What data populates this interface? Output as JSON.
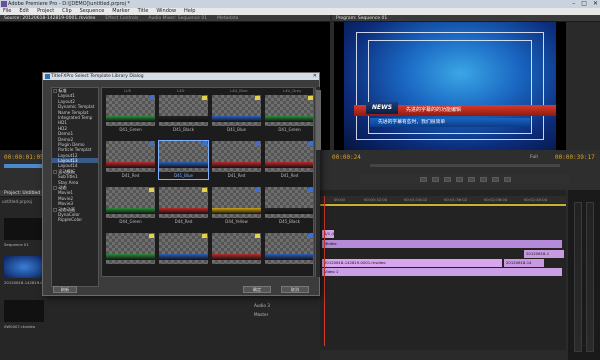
{
  "app": {
    "title": "Adobe Premiere Pro - D:\\[DEMO]\\untitled.prproj *",
    "menu": [
      "File",
      "Edit",
      "Project",
      "Clip",
      "Sequence",
      "Marker",
      "Title",
      "Window",
      "Help"
    ],
    "win_min": "–",
    "win_max": "□",
    "win_close": "✕"
  },
  "source_panel": {
    "tabs": [
      "Source: 20120618-142819-0001.rkvideo",
      "Effect Controls",
      "Audio Mixer: Sequence 01",
      "Metadata"
    ],
    "timecode": "00:00:01:05"
  },
  "program_panel": {
    "tabs": [
      "Program: Sequence 01"
    ],
    "timecode_left": "00:00:24",
    "timecode_right": "00:00:39:17",
    "fit_label": "Full",
    "news_tag": "NEWS",
    "news_text": "先进的字幕的的功能编辑",
    "sub_text": "先进的字幕有些时，我们很简单"
  },
  "dialog": {
    "title": "TitleFXPro Select Template Library Dialog",
    "tree": [
      {
        "label": "□ 标准",
        "kind": "grp"
      },
      {
        "label": "Layout1",
        "kind": "item"
      },
      {
        "label": "Layout2",
        "kind": "item"
      },
      {
        "label": "Dynamic Templat",
        "kind": "item"
      },
      {
        "label": "Name Templat",
        "kind": "item"
      },
      {
        "label": "Integrated Temp",
        "kind": "item"
      },
      {
        "label": "HD1",
        "kind": "item"
      },
      {
        "label": "HD2",
        "kind": "item"
      },
      {
        "label": "Demo1",
        "kind": "item"
      },
      {
        "label": "Demo2",
        "kind": "item"
      },
      {
        "label": "Plugin Demo",
        "kind": "item"
      },
      {
        "label": "Particle Templat",
        "kind": "item"
      },
      {
        "label": "Layout12",
        "kind": "item"
      },
      {
        "label": "Layout13",
        "kind": "sel"
      },
      {
        "label": "Layout14",
        "kind": "item"
      },
      {
        "label": "□ 运动模板",
        "kind": "grp"
      },
      {
        "label": "SubTitle1",
        "kind": "item"
      },
      {
        "label": "Stay Area",
        "kind": "item"
      },
      {
        "label": "□ 动态",
        "kind": "grp"
      },
      {
        "label": "Movie1",
        "kind": "item"
      },
      {
        "label": "Movie2",
        "kind": "item"
      },
      {
        "label": "Movie3",
        "kind": "item"
      },
      {
        "label": "□ 动态动画",
        "kind": "grp"
      },
      {
        "label": "DynaColor",
        "kind": "item"
      },
      {
        "label": "RippleColor",
        "kind": "item"
      }
    ],
    "column_headers": [
      "LUS",
      "L4D",
      "L4U_Blue",
      "L4U_Grey"
    ],
    "thumbs": [
      {
        "label": "D41_Green",
        "bar": "#2c8a3a",
        "badge": "blue"
      },
      {
        "label": "D41_Black",
        "bar": "#222222",
        "badge": "yellow"
      },
      {
        "label": "D41_Blue",
        "bar": "#2a5fb8",
        "badge": "yellow"
      },
      {
        "label": "D41_Green",
        "bar": "#2c8a3a",
        "badge": "yellow"
      },
      {
        "label": "D41_Red",
        "bar": "#b82a2a",
        "badge": "blue"
      },
      {
        "label": "D41_Blue",
        "bar": "#2a5fb8",
        "badge": "blue"
      },
      {
        "label": "D41_Red",
        "bar": "#b82a2a",
        "badge": "blue"
      },
      {
        "label": "D41_Red",
        "bar": "#b82a2a",
        "badge": "blue"
      },
      {
        "label": "D44_Green",
        "bar": "#2c8a3a",
        "badge": "yellow"
      },
      {
        "label": "D44_Red",
        "bar": "#b82a2a",
        "badge": "yellow"
      },
      {
        "label": "D44_Yellow",
        "bar": "#c9a21a",
        "badge": "blue"
      },
      {
        "label": "D45_Black",
        "bar": "#222222",
        "badge": "blue"
      },
      {
        "label": "",
        "bar": "#2c8a3a",
        "badge": "yellow"
      },
      {
        "label": "",
        "bar": "#2a5fb8",
        "badge": "yellow"
      },
      {
        "label": "",
        "bar": "#b82a2a",
        "badge": "yellow"
      },
      {
        "label": "",
        "bar": "#2a5fb8",
        "badge": "blue"
      }
    ],
    "selected_index": 5,
    "btn_left": "刷新",
    "btn_ok": "确定",
    "btn_cancel": "取消"
  },
  "project_panel": {
    "tabs": [
      "Project: Untitled",
      "Me"
    ],
    "file": "untitled.prproj",
    "items": [
      {
        "name": "Sequence 01",
        "info": ""
      },
      {
        "name": "20120618-142819-0001.rkvideo",
        "info": "00:00:01:06"
      },
      {
        "name": "00:00:0:11",
        "info": ""
      },
      {
        "name": "0W0007.rkvideo",
        "info": ""
      }
    ]
  },
  "timeline": {
    "ruler": [
      "00:00",
      "00:00:32:00",
      "00:01:04:02",
      "00:01:36:02",
      "00:02:08:04",
      "00:02:40:04"
    ],
    "clips": [
      {
        "label": "1/1 (W)",
        "color": "#d4a4e8"
      },
      {
        "label": "Middle",
        "color": "#b58ad8"
      },
      {
        "label": "20120618-1",
        "color": "#c99ae0"
      },
      {
        "label": "20120618-142819-0001.rkvideo",
        "color": "#d7a6ee"
      },
      {
        "label": "20120618-14",
        "color": "#c99ae0"
      },
      {
        "label": "Video 1",
        "color": "#c9a0e6"
      }
    ],
    "audio_tracks": [
      "Audio 3",
      "Master"
    ]
  }
}
